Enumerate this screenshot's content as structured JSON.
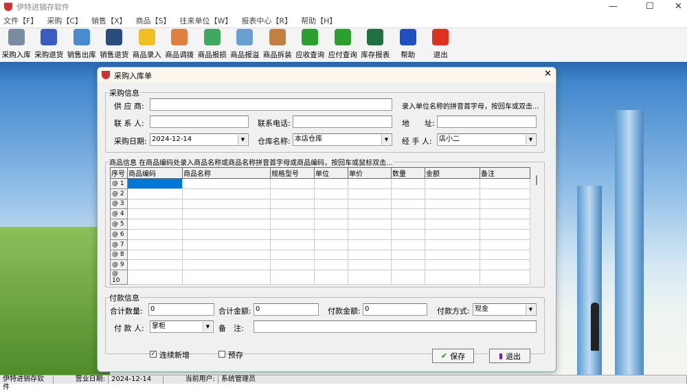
{
  "app": {
    "title": "伊特进销存软件"
  },
  "menu": [
    "文件【F】",
    "采购【C】",
    "销售【X】",
    "商品【S】",
    "往来单位【W】",
    "报表中心【R】",
    "帮助【H】"
  ],
  "toolbar": [
    {
      "label": "采购入库",
      "icon": "scroll-pen-icon",
      "color": "#7a8aa0"
    },
    {
      "label": "采购退货",
      "icon": "notepad-icon",
      "color": "#3a5cc0"
    },
    {
      "label": "销售出库",
      "icon": "form-edit-icon",
      "color": "#4a8ad0"
    },
    {
      "label": "销售退货",
      "icon": "door-icon",
      "color": "#2a4a80"
    },
    {
      "label": "商品录入",
      "icon": "star-icon",
      "color": "#f0c020"
    },
    {
      "label": "商品调拨",
      "icon": "house-icon",
      "color": "#e08040"
    },
    {
      "label": "商品报损",
      "icon": "recycle-bin-icon",
      "color": "#40a860"
    },
    {
      "label": "商品报溢",
      "icon": "magnifier-icon",
      "color": "#6aa0d0"
    },
    {
      "label": "商品拆装",
      "icon": "package-icon",
      "color": "#c08040"
    },
    {
      "label": "应收查询",
      "icon": "arrow-right-icon",
      "color": "#2aa030"
    },
    {
      "label": "应付查询",
      "icon": "arrow-left-icon",
      "color": "#2aa030"
    },
    {
      "label": "库存报表",
      "icon": "excel-icon",
      "color": "#207040"
    },
    {
      "label": "帮助",
      "icon": "help-icon",
      "color": "#2050c0"
    },
    {
      "label": "退出",
      "icon": "close-icon",
      "color": "#e03020"
    }
  ],
  "dialog": {
    "title": "采购入库单",
    "purchase": {
      "group": "采购信息",
      "supplier_label": "供 应 商:",
      "supplier_value": "",
      "hint": "录入单位名称的拼音首字母，按回车或双击...",
      "contact_label": "联 系 人:",
      "contact_value": "",
      "phone_label": "联系电话:",
      "phone_value": "",
      "address_label": "地　　址:",
      "address_value": "",
      "date_label": "采购日期:",
      "date_value": "2024-12-14",
      "warehouse_label": "仓库名称:",
      "warehouse_value": "本店仓库",
      "handler_label": "经 手 人:",
      "handler_value": "店小二"
    },
    "goods": {
      "group": "商品信息 在商品编码处录入商品名称或商品名称拼音首字母或商品编码，按回车或鼠标双击...",
      "columns": [
        "序号",
        "商品编码",
        "商品名称",
        "规格型号",
        "单位",
        "单价",
        "数量",
        "金额",
        "备注"
      ],
      "rows": [
        "@ 1",
        "@ 2",
        "@ 3",
        "@ 4",
        "@ 5",
        "@ 6",
        "@ 7",
        "@ 8",
        "@ 9",
        "@ 10"
      ]
    },
    "payment": {
      "group": "付款信息",
      "total_qty_label": "合计数量:",
      "total_qty": "0",
      "total_amount_label": "合计金额:",
      "total_amount": "0",
      "paid_label": "付款金额:",
      "paid": "0",
      "method_label": "付款方式:",
      "method": "现金",
      "payer_label": "付 款 人:",
      "payer": "掌柜",
      "note_label": "备　注:",
      "note": ""
    },
    "continuous_label": "连续新增",
    "continuous_checked": true,
    "prestore_label": "预存",
    "prestore_checked": false,
    "save_label": "保存",
    "exit_label": "退出"
  },
  "status": {
    "app": "伊特进销存软件",
    "date_label": "营业日期:",
    "date": "2024-12-14",
    "user_label": "当前用户:",
    "user": "系统管理员"
  }
}
